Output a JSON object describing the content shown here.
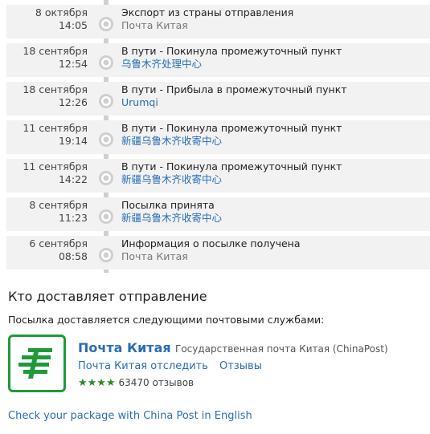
{
  "events": [
    {
      "date": "8 октября",
      "time": "14:05",
      "title": "Экспорт из страны отправления",
      "location": "Почта Китая",
      "loc_style": "gray"
    },
    {
      "date": "18 сентября",
      "time": "12:54",
      "title": "В пути - Покинула промежуточный пункт",
      "location": "乌鲁木齐处理中心",
      "loc_style": "link"
    },
    {
      "date": "18 сентября",
      "time": "12:26",
      "title": "В пути - Прибыла в промежуточный пункт",
      "location": "Urumqi",
      "loc_style": "link"
    },
    {
      "date": "11 сентября",
      "time": "19:14",
      "title": "В пути - Покинула промежуточный пункт",
      "location": "新疆乌鲁木齐收寄中心",
      "loc_style": "link"
    },
    {
      "date": "11 сентября",
      "time": "14:22",
      "title": "В пути - Покинула промежуточный пункт",
      "location": "新疆乌鲁木齐收寄中心",
      "loc_style": "link"
    },
    {
      "date": "8 сентября",
      "time": "11:23",
      "title": "Посылка принята",
      "location": "新疆乌鲁木齐收寄中心",
      "loc_style": "link"
    },
    {
      "date": "6 сентября",
      "time": "08:58",
      "title": "Информация о посылке получена",
      "location": "Почта Китая",
      "loc_style": "gray"
    }
  ],
  "delivery": {
    "title": "Кто доставляет отправление",
    "subtitle": "Посылка доставляется следующими почтовыми службами:",
    "carrier": {
      "name": "Почта Китая",
      "description": "Государственная почта Китая (ChinaPost)",
      "track_link": "Почта Китая отследить",
      "reviews_link": "Отзывы",
      "stars": "★★★★",
      "reviews_count": "63470 отзывов",
      "logo_icon": "china-post-logo",
      "brand_color": "#1f9a3a"
    },
    "english_link": "Check your package with China Post in English"
  }
}
